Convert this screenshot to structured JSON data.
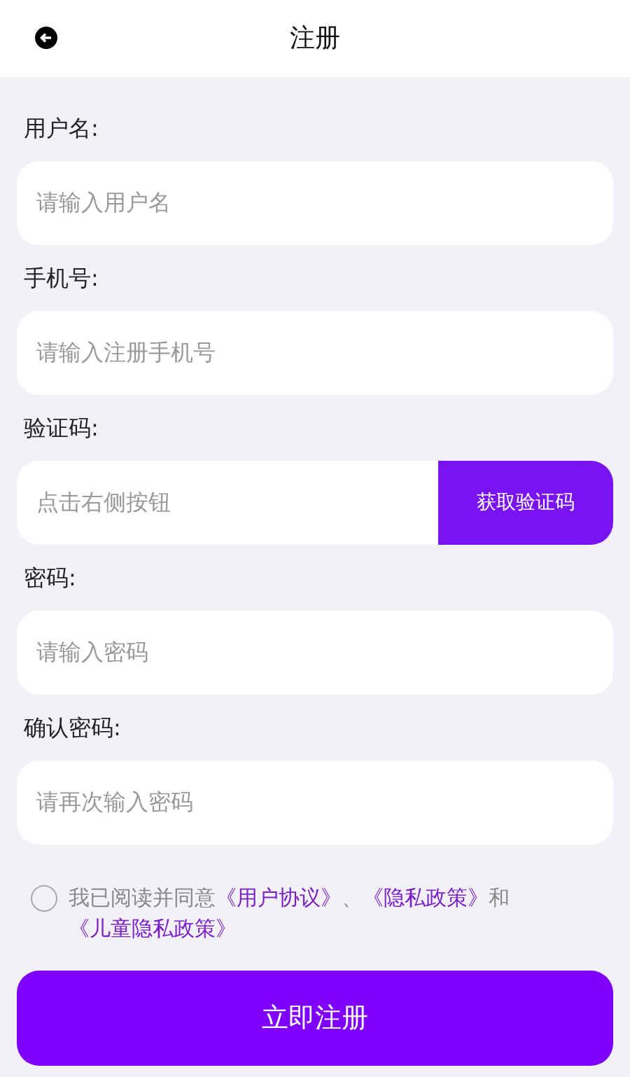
{
  "header": {
    "title": "注册"
  },
  "fields": [
    {
      "label": "用户名:",
      "placeholder": "请输入用户名"
    },
    {
      "label": "手机号:",
      "placeholder": "请输入注册手机号"
    },
    {
      "label": "验证码:",
      "placeholder": "点击右侧按钮",
      "button": "获取验证码"
    },
    {
      "label": "密码:",
      "placeholder": "请输入密码"
    },
    {
      "label": "确认密码:",
      "placeholder": "请再次输入密码"
    }
  ],
  "agreement": {
    "checked": false,
    "parts": [
      {
        "kind": "text",
        "text": "我已阅读并同意"
      },
      {
        "kind": "link",
        "text": "《用户协议》"
      },
      {
        "kind": "text",
        "text": "、"
      },
      {
        "kind": "link",
        "text": "《隐私政策》"
      },
      {
        "kind": "text",
        "text": "和"
      },
      {
        "kind": "link",
        "text": "《儿童隐私政策》"
      }
    ]
  },
  "submit": "立即注册"
}
